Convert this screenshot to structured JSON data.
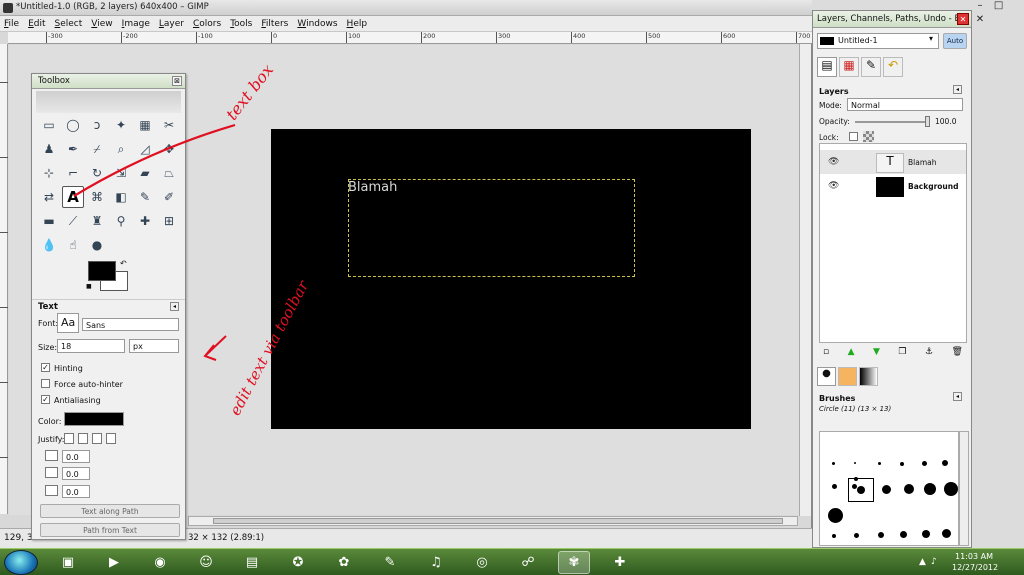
{
  "titlebar": {
    "title": "*Untitled-1.0 (RGB, 2 layers) 640x400 – GIMP"
  },
  "menubar": {
    "items": [
      "File",
      "Edit",
      "Select",
      "View",
      "Image",
      "Layer",
      "Colors",
      "Tools",
      "Filters",
      "Windows",
      "Help"
    ]
  },
  "ruler": {
    "ticks": [
      "-300",
      "-200",
      "-100",
      "0",
      "100",
      "200",
      "300",
      "400",
      "500",
      "600",
      "700"
    ]
  },
  "canvas": {
    "text_layer_content": "Blamah",
    "background_color": "#000000"
  },
  "statusbar": {
    "coords": "129, 3",
    "size_text": "32 × 132 (2.89:1)"
  },
  "toolbox": {
    "title": "Toolbox",
    "close_glyph": "⊠",
    "tools": [
      "rect-select",
      "ellipse-select",
      "free-select",
      "fuzzy-select",
      "select-by-color",
      "scissors-select",
      "foreground-select",
      "paths",
      "color-picker",
      "zoom",
      "measure",
      "move",
      "align",
      "crop",
      "rotate",
      "scale",
      "shear",
      "perspective",
      "flip",
      "text",
      "cage",
      "blend",
      "pencil",
      "paintbrush",
      "eraser",
      "airbrush",
      "ink",
      "clone",
      "heal",
      "smudge",
      "blur",
      "dodge",
      "perspective-clone"
    ],
    "foreground_color": "#000000",
    "background_color": "#ffffff"
  },
  "text_options": {
    "header": "Text",
    "font_label": "Font:",
    "font_preview": "Aa",
    "font_value": "Sans",
    "size_label": "Size:",
    "size_value": "18",
    "unit_value": "px",
    "hinting_label": "Hinting",
    "force_autohinter_label": "Force auto-hinter",
    "antialiasing_label": "Antialiasing",
    "color_label": "Color:",
    "color_value": "#000000",
    "justify_label": "Justify:",
    "indent_value": "0.0",
    "line_spacing_value": "0.0",
    "letter_spacing_value": "0.0",
    "text_along_path_label": "Text along Path",
    "path_from_text_label": "Path from Text"
  },
  "layers_window": {
    "title": "Layers, Channels, Paths, Undo - B...",
    "image_select": "Untitled-1",
    "auto_label": "Auto",
    "layers_header": "Layers",
    "mode_label": "Mode:",
    "mode_value": "Normal",
    "opacity_label": "Opacity:",
    "opacity_value": "100.0",
    "lock_label": "Lock:",
    "layers": [
      {
        "name": "Blamah",
        "type": "text"
      },
      {
        "name": "Background",
        "type": "image"
      }
    ],
    "brushes_header": "Brushes",
    "brush_name": "Circle (11) (13 × 13)"
  },
  "window_controls": {
    "minimize": "–",
    "maximize": "□",
    "close": "✕"
  },
  "taskbar": {
    "clock_time": "11:03 AM",
    "clock_date": "12/27/2012"
  },
  "annotations": {
    "text_box": "text box",
    "edit_text": "edit text via toolbar"
  }
}
